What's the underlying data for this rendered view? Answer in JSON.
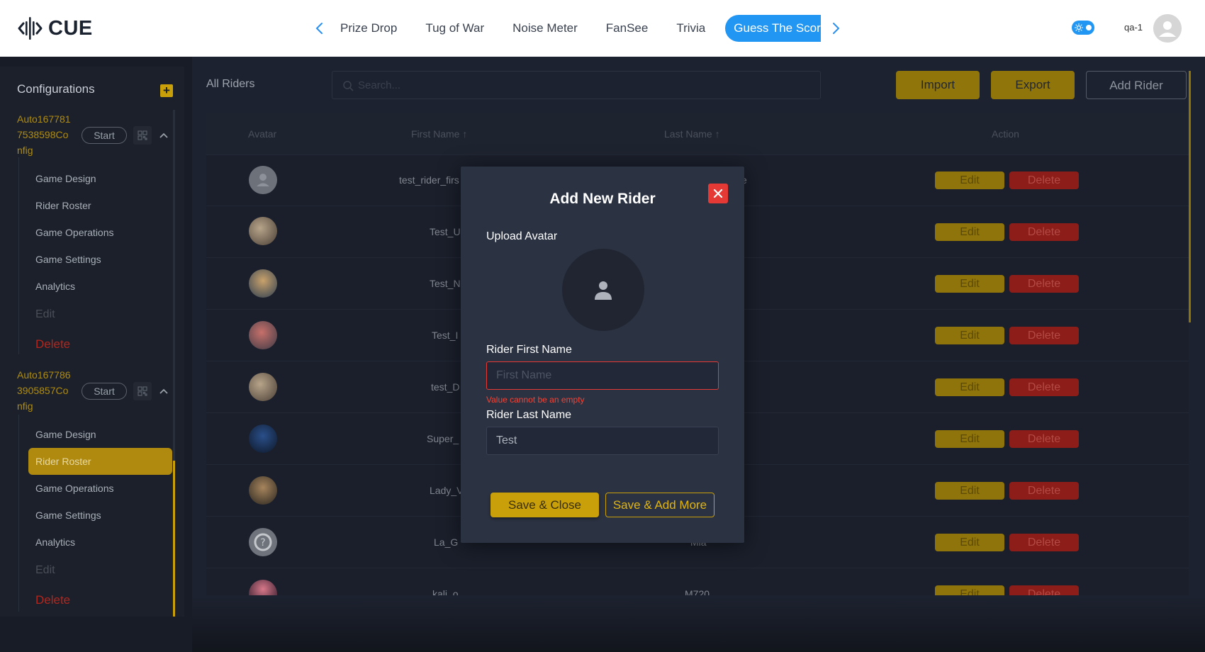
{
  "brand": {
    "name": "CUE"
  },
  "nav": {
    "tabs": [
      {
        "label": "Prize Drop"
      },
      {
        "label": "Tug of War"
      },
      {
        "label": "Noise Meter"
      },
      {
        "label": "FanSee"
      },
      {
        "label": "Trivia"
      },
      {
        "label": "Guess The Score"
      }
    ],
    "active_tab": "Guess The Score"
  },
  "user": {
    "name": "qa-1"
  },
  "sidebar": {
    "title": "Configurations",
    "configs": [
      {
        "name": "Auto1677817538598Config",
        "name_lines": [
          "Auto167781",
          "7538598Co",
          "nfig"
        ],
        "start_label": "Start",
        "items": [
          "Game Design",
          "Rider Roster",
          "Game Operations",
          "Game Settings",
          "Analytics"
        ],
        "edit_label": "Edit",
        "delete_label": "Delete"
      },
      {
        "name": "Auto1677863905857Config",
        "name_lines": [
          "Auto167786",
          "3905857Co",
          "nfig"
        ],
        "start_label": "Start",
        "items": [
          "Game Design",
          "Rider Roster",
          "Game Operations",
          "Game Settings",
          "Analytics"
        ],
        "edit_label": "Edit",
        "delete_label": "Delete",
        "selected_item": "Rider Roster"
      }
    ]
  },
  "main": {
    "title": "All Riders",
    "search_placeholder": "Search...",
    "buttons": {
      "import": "Import",
      "export": "Export",
      "add": "Add Rider"
    },
    "columns": [
      "Avatar",
      "First Name",
      "Last Name",
      "Action"
    ],
    "rows": [
      {
        "first": "test_rider_firs",
        "last": "e",
        "avatar": "placeholder"
      },
      {
        "first": "Test_U",
        "last": "",
        "avatar": "art-1"
      },
      {
        "first": "Test_N",
        "last": "",
        "avatar": "art-2"
      },
      {
        "first": "Test_I",
        "last": "",
        "avatar": "art-3"
      },
      {
        "first": "test_D",
        "last": "",
        "avatar": "art-1"
      },
      {
        "first": "Super_",
        "last": "",
        "avatar": "art-4"
      },
      {
        "first": "Lady_V",
        "last": "",
        "avatar": "art-5"
      },
      {
        "first": "La_G",
        "last": "Mia",
        "avatar": "art-6"
      },
      {
        "first": "kali_o",
        "last": "M720",
        "avatar": "art-7"
      }
    ],
    "row_edit_label": "Edit",
    "row_delete_label": "Delete"
  },
  "modal": {
    "title": "Add New Rider",
    "upload_label": "Upload Avatar",
    "first_name_label": "Rider First Name",
    "first_name_placeholder": "First Name",
    "first_name_value": "",
    "first_name_error": "Value cannot be an empty",
    "last_name_label": "Rider Last Name",
    "last_name_value": "Test",
    "save_close_label": "Save & Close",
    "save_more_label": "Save & Add More"
  },
  "colors": {
    "accent_blue": "#2196f3",
    "gold": "#c9a00a",
    "danger": "#e53935",
    "modal_bg": "#2b3242"
  }
}
